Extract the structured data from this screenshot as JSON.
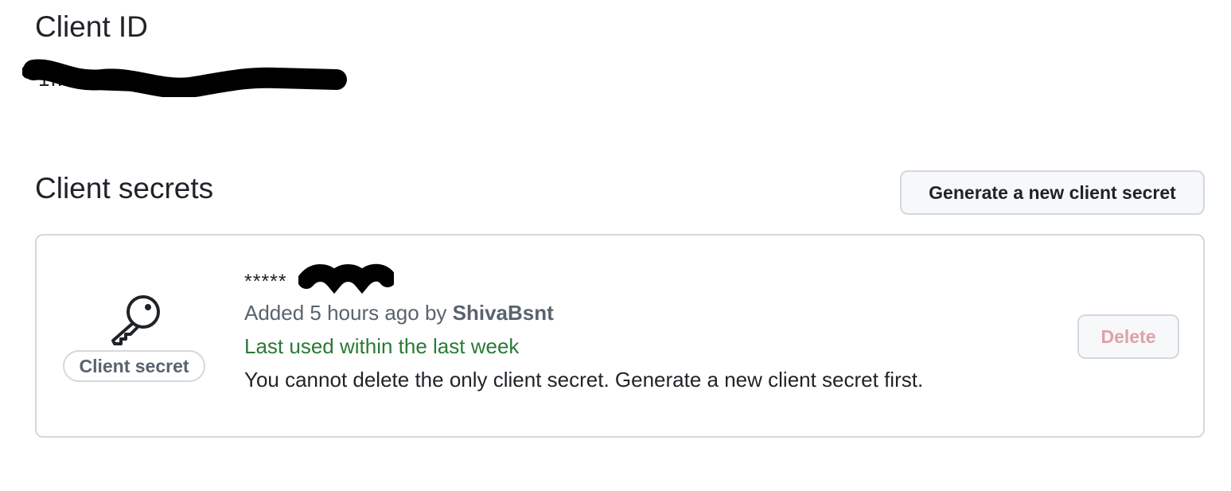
{
  "client_id": {
    "heading": "Client ID",
    "value_redacted": "1f..."
  },
  "client_secrets": {
    "heading": "Client secrets",
    "generate_button": "Generate a new client secret",
    "secret": {
      "badge": "Client secret",
      "icon": "key-icon",
      "masked_value": "*****",
      "added_prefix": "Added 5 hours ago by ",
      "author": "ShivaBsnt",
      "last_used": "Last used within the last week",
      "delete_note": "You cannot delete the only client secret. Generate a new client secret first.",
      "delete_button": "Delete"
    }
  },
  "colors": {
    "text": "#1f2328",
    "muted": "#59636e",
    "success": "#2a7a35",
    "danger_disabled": "#e0a0a6",
    "border": "#d1d9e0",
    "button_bg": "#f6f8fa"
  }
}
